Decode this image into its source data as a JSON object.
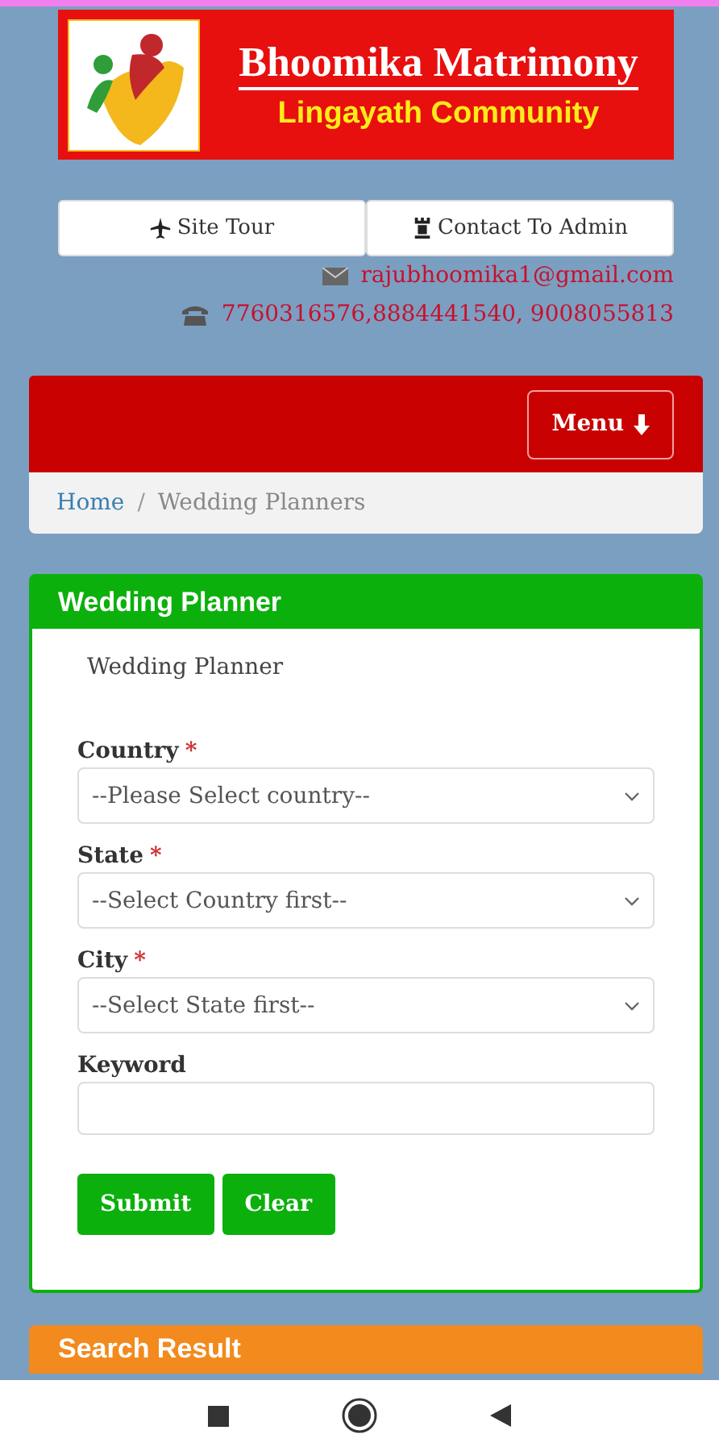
{
  "banner": {
    "title": "Bhoomika Matrimony",
    "subtitle": "Lingayath Community"
  },
  "quick_links": [
    {
      "label": "Site Tour"
    },
    {
      "label": "Contact To Admin"
    }
  ],
  "contact": {
    "email": "rajubhoomika1@gmail.com",
    "phone": "7760316576,8884441540, 9008055813"
  },
  "navbar": {
    "menu_button": "Menu"
  },
  "breadcrumb": {
    "separator": "/",
    "items": [
      {
        "label": "Home",
        "link": true
      },
      {
        "label": "Wedding Planners",
        "link": false
      }
    ]
  },
  "panel": {
    "title": "Wedding Planner",
    "heading": "Wedding Planner",
    "fields": [
      {
        "kind": "select",
        "label": "Country",
        "required_mark": "*",
        "value": "--Please Select country--"
      },
      {
        "kind": "select",
        "label": "State",
        "required_mark": "*",
        "value": "--Select Country first--"
      },
      {
        "kind": "select",
        "label": "City",
        "required_mark": "*",
        "value": "--Select State first--"
      },
      {
        "kind": "input",
        "label": "Keyword"
      }
    ],
    "buttons": [
      "Submit",
      "Clear"
    ]
  },
  "results_panel": {
    "title": "Search Result"
  }
}
